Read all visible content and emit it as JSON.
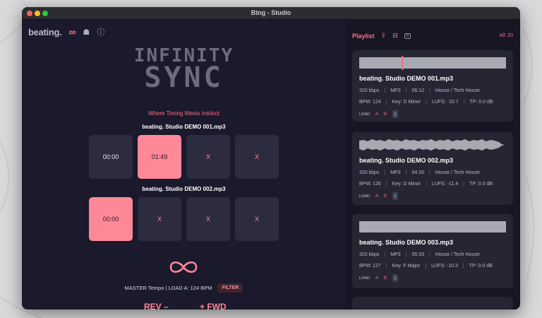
{
  "window": {
    "title": "Btng - Studio"
  },
  "brand": {
    "name": "beating.",
    "infinity_icon": "∞",
    "profile_icon": "☗",
    "info_icon": "ⓘ"
  },
  "logo": {
    "line1": "INFINITY",
    "line2": "SYNC"
  },
  "tagline": "Where Timing Meets Instinct",
  "tracks": [
    {
      "label": "beating. Studio DEMO 001.mp3",
      "pads": [
        {
          "text": "00:00",
          "state": "neutral"
        },
        {
          "text": "01:49",
          "state": "active"
        },
        {
          "text": "X",
          "state": "empty"
        },
        {
          "text": "X",
          "state": "empty"
        }
      ]
    },
    {
      "label": "beating. Studio DEMO 002.mp3",
      "pads": [
        {
          "text": "00:00",
          "state": "active"
        },
        {
          "text": "X",
          "state": "empty"
        },
        {
          "text": "X",
          "state": "empty"
        },
        {
          "text": "X",
          "state": "empty"
        }
      ]
    }
  ],
  "master": {
    "tempo_text": "MASTER Tempo | LOAD A: 124 BPM",
    "filter_label": "FILTER"
  },
  "transport": {
    "rev_label": "REV –",
    "fwd_label": "+ FWD"
  },
  "playlist": {
    "title": "Playlist",
    "badge": "0",
    "count": "All: 20",
    "items": [
      {
        "name": "beating. Studio DEMO 001.mp3",
        "bitrate": "320 kbps",
        "format": "MP3",
        "duration": "06:12",
        "genre": "House / Tech House",
        "bpm": "BPM: 124",
        "key": "Key: D Minor",
        "lufs": "LUFS: -10.7",
        "tp": "TP: 0.0 dB",
        "load": "LOAD",
        "a": "A",
        "b": "B",
        "playhead": 0.29
      },
      {
        "name": "beating. Studio DEMO 002.mp3",
        "bitrate": "320 kbps",
        "format": "MP3",
        "duration": "04:26",
        "genre": "House / Tech House",
        "bpm": "BPM: 126",
        "key": "Key: D Minor",
        "lufs": "LUFS: -11.4",
        "tp": "TP: 0.0 dB",
        "load": "LOAD",
        "a": "A",
        "b": "B"
      },
      {
        "name": "beating. Studio DEMO 003.mp3",
        "bitrate": "320 kbps",
        "format": "MP3",
        "duration": "05:33",
        "genre": "House / Tech House",
        "bpm": "BPM: 127",
        "key": "Key: F Major",
        "lufs": "LUFS: -10.3",
        "tp": "TP: 0.0 dB",
        "load": "LOAD",
        "a": "A",
        "b": "B"
      }
    ]
  },
  "colors": {
    "accent": "#ff6f85",
    "pad_active": "#ff8898",
    "window_bg": "#1a1a2c",
    "card_bg": "#252533"
  }
}
